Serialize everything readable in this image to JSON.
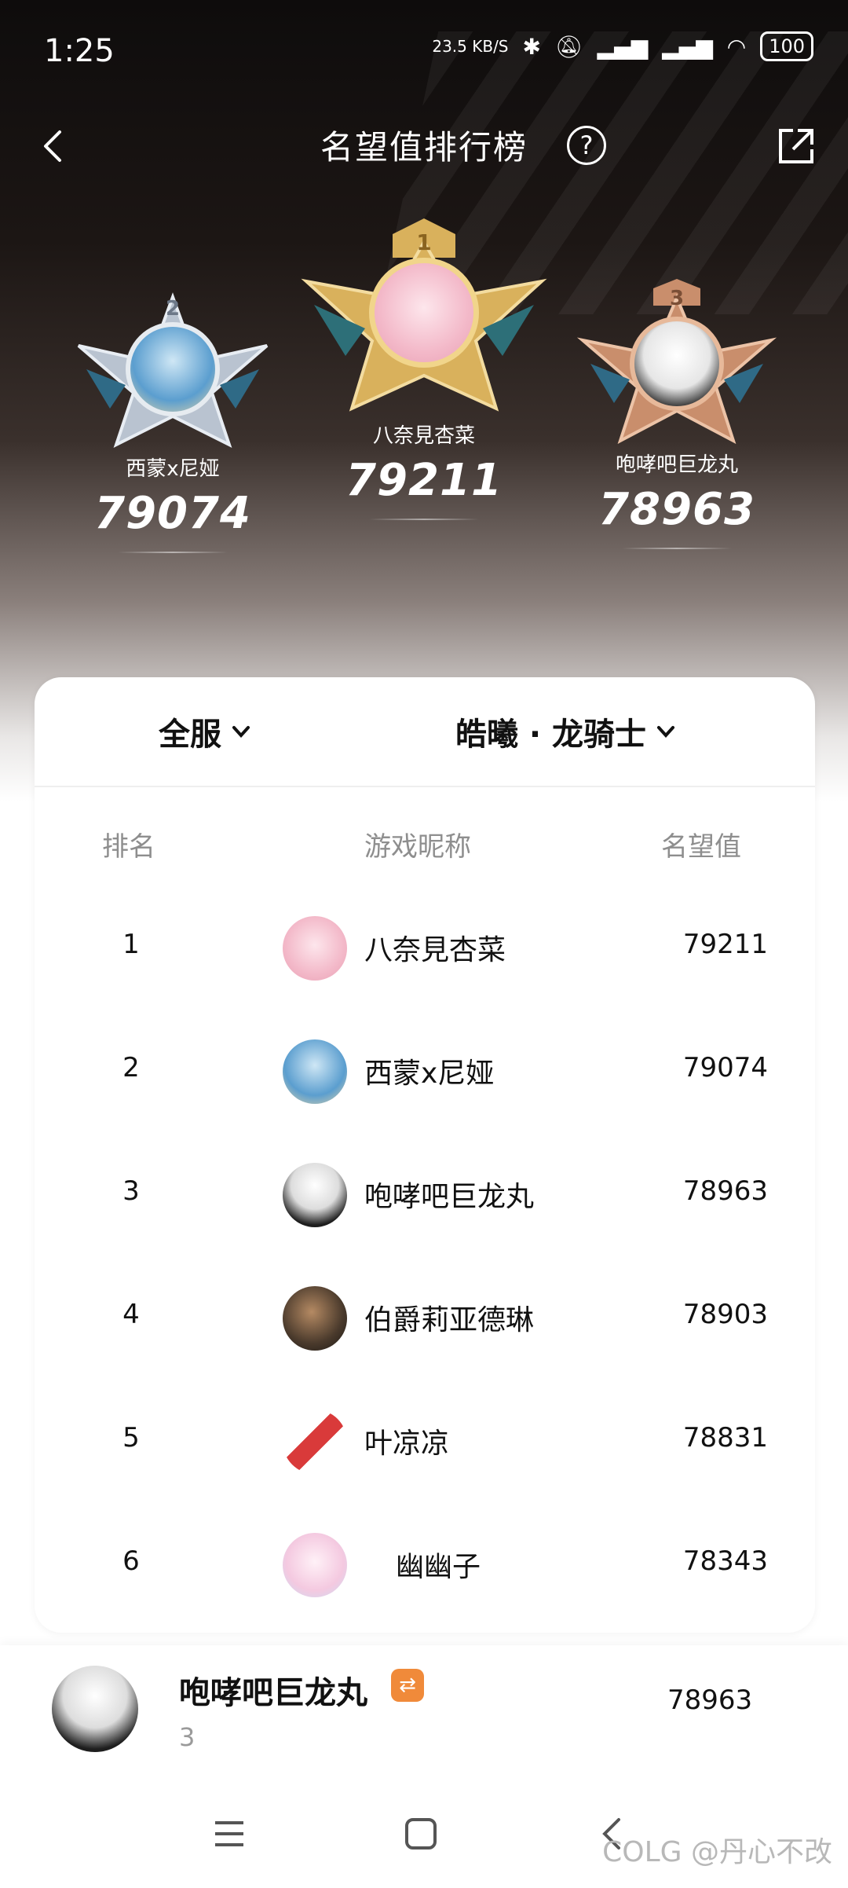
{
  "status_bar": {
    "time": "1:25",
    "speed": "23.5 KB/S",
    "battery": "100"
  },
  "header": {
    "title": "名望值排行榜",
    "help_label": "?"
  },
  "podium": [
    {
      "rank": "2",
      "name": "西蒙x尼娅",
      "score": "79074"
    },
    {
      "rank": "1",
      "name": "八奈見杏菜",
      "score": "79211"
    },
    {
      "rank": "3",
      "name": "咆哮吧巨龙丸",
      "score": "78963"
    }
  ],
  "filters": {
    "server": "全服",
    "class": "皓曦 · 龙骑士"
  },
  "table": {
    "headers": {
      "rank": "排名",
      "name": "游戏昵称",
      "score": "名望值"
    },
    "rows": [
      {
        "rank": "1",
        "name": "八奈見杏菜",
        "score": "79211"
      },
      {
        "rank": "2",
        "name": "西蒙x尼娅",
        "score": "79074"
      },
      {
        "rank": "3",
        "name": "咆哮吧巨龙丸",
        "score": "78963"
      },
      {
        "rank": "4",
        "name": "伯爵莉亚德琳",
        "score": "78903"
      },
      {
        "rank": "5",
        "name": "叶凉凉",
        "score": "78831"
      },
      {
        "rank": "6",
        "name": "幽幽子",
        "score": "78343"
      }
    ]
  },
  "my_rank": {
    "name": "咆哮吧巨龙丸",
    "rank": "3",
    "score": "78963",
    "swap_icon": "swap-icon"
  },
  "watermark": "COLG @丹心不改",
  "colors": {
    "gold": "#d9b15c",
    "silver": "#b9c3d0",
    "bronze": "#c98e6c",
    "accent": "#f08a3a"
  }
}
